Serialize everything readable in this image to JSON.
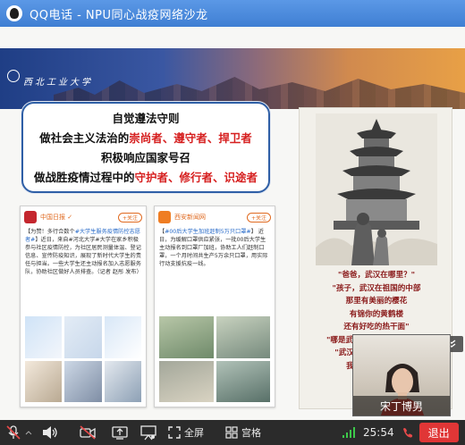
{
  "window": {
    "title": "QQ电话 - NPU同心战疫网络沙龙"
  },
  "slide": {
    "banner_logo_text": "西北工业大学",
    "textbox_lines": [
      {
        "parts": [
          {
            "text": "自觉遵法守则",
            "red": false
          }
        ]
      },
      {
        "parts": [
          {
            "text": "做社会主义法治的",
            "red": false
          },
          {
            "text": "崇尚者、遵守者、捍卫者",
            "red": true
          }
        ]
      },
      {
        "parts": [
          {
            "text": "积极响应国家号召",
            "red": false
          }
        ]
      },
      {
        "parts": [
          {
            "text": "做战胜疫情过程中的",
            "red": false
          },
          {
            "text": "守护者、修行者、识途者",
            "red": true
          }
        ]
      }
    ],
    "card1": {
      "name": "中国日报 ✓",
      "follow": "+关注",
      "text_before": "【为赞！多行合数个",
      "text_hl": "#大学生服务疫情防控志愿者#",
      "text_after": "】近日，来自#河北大学#大学在家乡积极参与社区疫情防控，为社区居民测量体温、登记信息、宣传防疫知识，展现了新时代大学生的责任与担当。一些大学生还主动报名加入志愿服务队，协助社区做好人员排查。（记者 赵彤 发布）"
    },
    "card2": {
      "name": "西安新闻网",
      "follow": "+关注",
      "text_before": "【",
      "text_hl": "#00后大学生加班赶制5万只口罩#",
      "text_after": "】 近日，为缓解口罩供应紧张，一批00后大学生主动报名到口罩厂加班，协助工人们赶制口罩，一个月时间共生产5万余只口罩，用实际行动支援抗疫一线。"
    },
    "poster_verse": [
      "\"爸爸，武汉在哪里？\"",
      "\"孩子，武汉在祖国的中部",
      "那里有美丽的樱花",
      "有锦你的黄鹤楼",
      "还有好吃的热干面\"",
      "\"哪是武汉病了，能治好吗？\"",
      "\"武汉只 一定能够好起来",
      "我们一起 等春天\""
    ],
    "collapse_label": "收起"
  },
  "video": {
    "name": "宋丁博男"
  },
  "toolbar": {
    "fullscreen_label": "全屏",
    "grid_label": "宫格",
    "time": "25:54",
    "exit_label": "退出"
  }
}
